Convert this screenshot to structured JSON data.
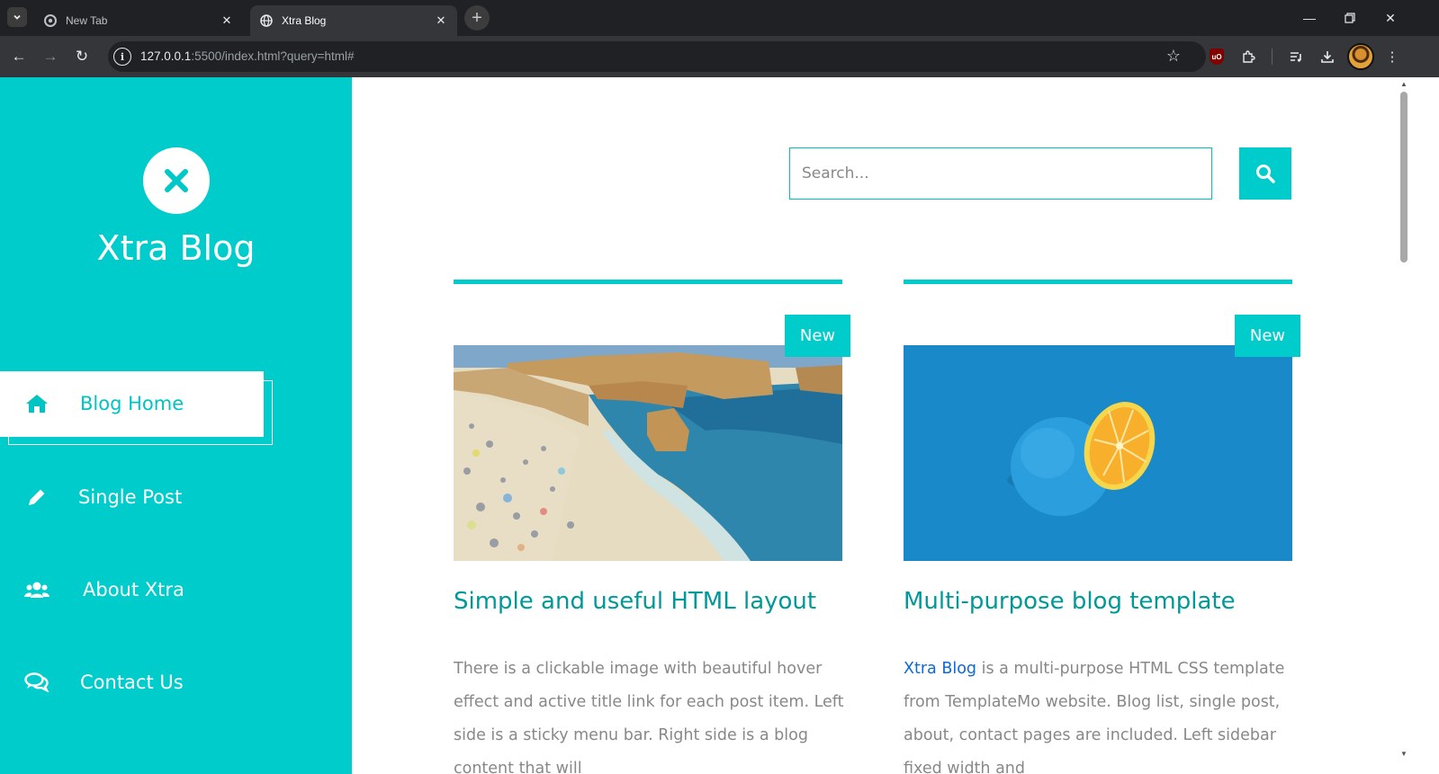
{
  "browser": {
    "tabs": [
      {
        "title": "New Tab",
        "icon": "chrome-icon",
        "active": false
      },
      {
        "title": "Xtra Blog",
        "icon": "globe-icon",
        "active": true
      }
    ],
    "url_host": "127.0.0.1",
    "url_rest": ":5500/index.html?query=html#",
    "colors": {
      "tabbar": "#202124",
      "toolbar": "#35363a"
    }
  },
  "sidebar": {
    "site_title": "Xtra Blog",
    "logo_icon": "close-x-icon",
    "nav": [
      {
        "label": "Blog Home",
        "icon": "home-icon",
        "active": true
      },
      {
        "label": "Single Post",
        "icon": "pencil-icon",
        "active": false
      },
      {
        "label": "About Xtra",
        "icon": "users-icon",
        "active": false
      },
      {
        "label": "Contact Us",
        "icon": "comments-icon",
        "active": false
      }
    ],
    "color": "#00cccc"
  },
  "search": {
    "placeholder": "Search...",
    "button_icon": "search-icon"
  },
  "posts": [
    {
      "badge": "New",
      "title": "Simple and useful HTML layout",
      "excerpt": "There is a clickable image with beautiful hover effect and active title link for each post item. Left side is a sticky menu bar. Right side is a blog content that will",
      "image": "beach-photo"
    },
    {
      "badge": "New",
      "title": "Multi-purpose blog template",
      "excerpt_link": "Xtra Blog",
      "excerpt": " is a multi-purpose HTML CSS template from TemplateMo website. Blog list, single post, about, contact pages are included. Left sidebar fixed width and",
      "image": "orange-photo"
    }
  ],
  "accent_color": "#00cccc",
  "title_color": "#009999"
}
